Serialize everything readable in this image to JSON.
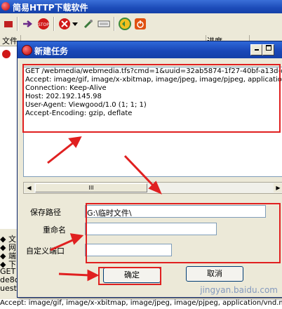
{
  "app": {
    "title": "简易HTTP下载软件"
  },
  "toolbar": {
    "icons": [
      "red-icon",
      "arrow-right-icon",
      "stop-icon",
      "delete-icon",
      "dropdown-icon",
      "tools-icon",
      "keyboard-icon",
      "refresh-icon",
      "power-icon"
    ]
  },
  "list": {
    "columns": [
      "文件",
      "...",
      "进度"
    ],
    "side_texts": [
      "◆ 文",
      "◆ 网",
      "◆ 端",
      "◆ 下",
      "GET",
      "de8d",
      "uest\\"
    ],
    "bottom_text": "Accept: image/gif, image/x-xbitmap, image/jpeg, image/pjpeg, application/vnd.ms-pov"
  },
  "dialog": {
    "title": "新建任务",
    "request_lines": [
      "GET /webmedia/webmedia.tfs?cmd=1&uuid=32ab5874-1f27-40bf-a13d-de8",
      "Accept: image/gif, image/x-xbitmap, image/jpeg, image/pjpeg, application/v",
      "Connection: Keep-Alive",
      "Host: 202.192.145.98",
      "User-Agent: Viewgood/1.0 (1; 1; 1)",
      "Accept-Encoding: gzip, deflate"
    ],
    "save_path_label": "保存路径",
    "save_path_value": "G:\\临时文件\\",
    "rename_label": "重命名",
    "rename_value": "",
    "port_label": "自定义端口",
    "port_value": "",
    "ok_label": "确定",
    "cancel_label": "取消"
  },
  "watermark": "jingyan.baidu.com",
  "colors": {
    "title_blue": "#1c4bb8",
    "annotation_red": "#e02020"
  }
}
